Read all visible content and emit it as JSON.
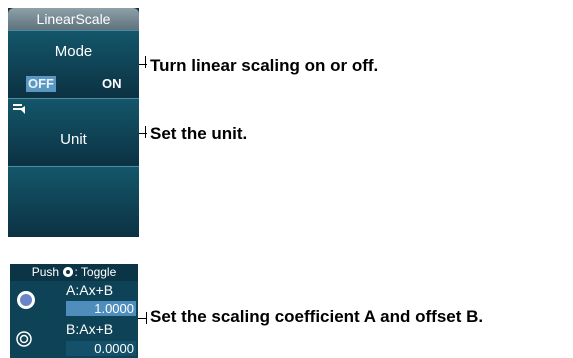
{
  "menu": {
    "title": "LinearScale",
    "mode": {
      "label": "Mode",
      "options": [
        "OFF",
        "ON"
      ],
      "selected": "OFF"
    },
    "unit": {
      "label": "Unit",
      "icon": "keyboard-icon"
    },
    "empty_key": ""
  },
  "callouts": {
    "mode": "Turn linear scaling on or off.",
    "unit": "Set the unit.",
    "coefficients": "Set the scaling coefficient A and offset B."
  },
  "jog": {
    "title_prefix": "Push",
    "title_suffix": ": Toggle",
    "a": {
      "label": "A:Ax+B",
      "value": "1.0000"
    },
    "b": {
      "label": "B:Ax+B",
      "value": "0.0000"
    }
  },
  "colors": {
    "panel": "#0c3545",
    "selected_option": "#5a97c2",
    "value_field": "#4f8dbd"
  }
}
